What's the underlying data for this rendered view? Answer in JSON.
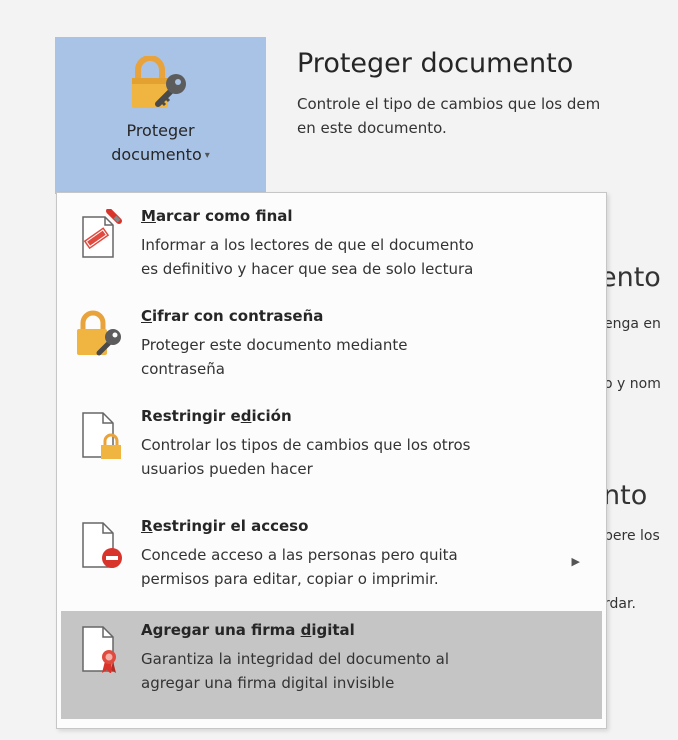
{
  "protect_button": {
    "label_line1": "Proteger",
    "label_line2": "documento",
    "caret": "▾",
    "icon": "lock-key-icon"
  },
  "header": {
    "title": "Proteger documento",
    "desc_line1": "Controle el tipo de cambios que los dem",
    "desc_line2": "en este documento."
  },
  "background_fragments": {
    "a": "ento",
    "b": "enga en",
    "c": "o y nom",
    "d": "nto",
    "e": "pere los",
    "f": "rdar."
  },
  "menu": {
    "items": [
      {
        "title_pre": "",
        "title_u": "M",
        "title_post": "arcar como final",
        "desc": "Informar a los lectores de que el documento\nes definitivo y hacer que sea de solo lectura",
        "icon": "mark-final-icon"
      },
      {
        "title_pre": "",
        "title_u": "C",
        "title_post": "ifrar con contraseña",
        "desc": "Proteger este documento mediante\ncontraseña",
        "icon": "lock-key-icon"
      },
      {
        "title_pre": "Restringir e",
        "title_u": "d",
        "title_post": "ición",
        "desc": "Controlar los tipos de cambios que los otros\nusuarios pueden hacer",
        "icon": "document-lock-icon"
      },
      {
        "title_pre": "",
        "title_u": "R",
        "title_post": "estringir el acceso",
        "desc": "Concede acceso a las personas pero quita\npermisos para editar, copiar o imprimir.",
        "icon": "document-restrict-icon",
        "submenu_arrow": "▶"
      },
      {
        "title_pre": "Agregar una firma ",
        "title_u": "d",
        "title_post": "igital",
        "desc": "Garantiza la integridad del documento al\nagregar una firma digital invisible",
        "icon": "document-signature-icon"
      }
    ]
  }
}
